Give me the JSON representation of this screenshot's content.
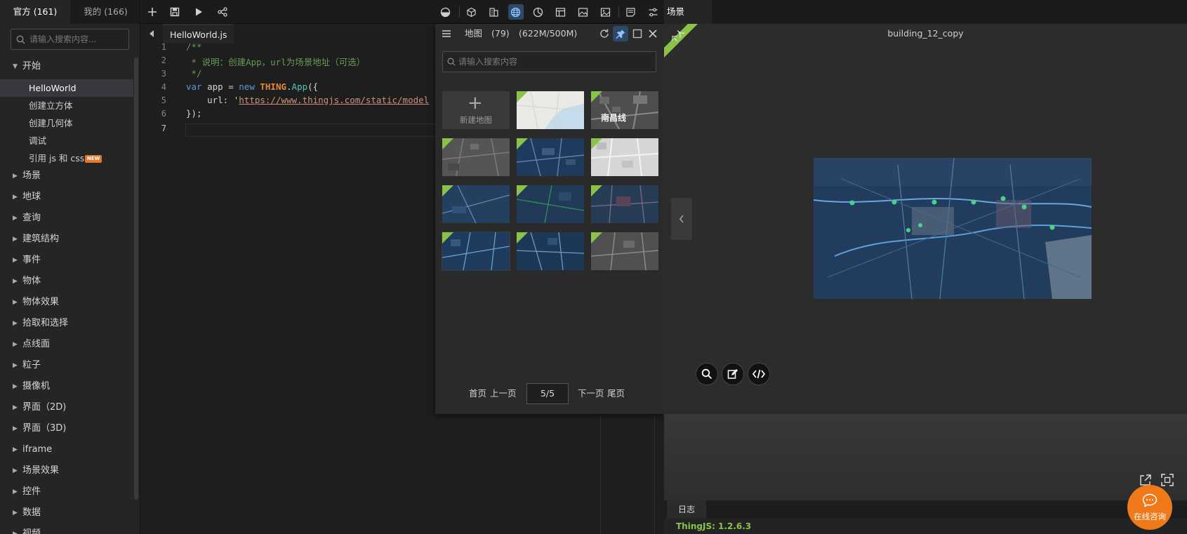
{
  "sidebar": {
    "tabs": [
      {
        "label": "官方",
        "count": "(161)"
      },
      {
        "label": "我的",
        "count": "(166)"
      }
    ],
    "search_placeholder": "请输入搜索内容...",
    "tree": {
      "expanded": {
        "label": "开始",
        "children": [
          {
            "label": "HelloWorld",
            "selected": true
          },
          {
            "label": "创建立方体"
          },
          {
            "label": "创建几何体"
          },
          {
            "label": "调试"
          },
          {
            "label": "引用 js 和 css",
            "badge": "NEW"
          }
        ]
      },
      "collapsed": [
        "场景",
        "地球",
        "查询",
        "建筑结构",
        "事件",
        "物体",
        "物体效果",
        "拾取和选择",
        "点线面",
        "粒子",
        "摄像机",
        "界面（2D)",
        "界面（3D)",
        "iframe",
        "场景效果",
        "控件",
        "数据",
        "视频"
      ]
    }
  },
  "toolbar": {
    "left_icons": [
      "plus-icon",
      "save-icon",
      "run-icon",
      "share-icon"
    ],
    "right_icons": [
      "layers-icon",
      "cube-icon",
      "building-icon",
      "globe-icon",
      "chart-icon",
      "layout-icon",
      "image-icon",
      "gallery-icon",
      "note-icon",
      "settings-icon"
    ],
    "active_icon": "globe-icon"
  },
  "editor": {
    "file_tab": "HelloWorld.js",
    "lines": [
      "1",
      "2",
      "3",
      "4",
      "5",
      "6",
      "7"
    ],
    "code": {
      "l1": "/**",
      "l2": " * 说明：创建App，url为场景地址（可选）",
      "l3": " */",
      "l4_kw": "var",
      "l4_a": " app = ",
      "l4_new": "new",
      "l4_sp": " ",
      "l4_cls": "THING",
      "l4_dot": ".",
      "l4_fn": "App",
      "l4_b": "({",
      "l5_a": "    url: '",
      "l5_str": "https://www.thingjs.com/static/model",
      "l6": "});"
    }
  },
  "map_panel": {
    "title": "地图",
    "count": "(79)",
    "size": "(622M/500M)",
    "search_placeholder": "请输入搜索内容",
    "new_map_label": "新建地图",
    "thumb_road_label": "南昌线",
    "pager": {
      "first": "首页",
      "prev": "上一页",
      "page": "5/5",
      "next": "下一页",
      "last": "尾页"
    }
  },
  "scene": {
    "tab_label": "场景",
    "title": "building_12_copy",
    "ribbon_label": "个人",
    "log_tab": "日志",
    "log_text": "ThingJS: 1.2.6.3",
    "consult_label": "在线咨询"
  },
  "colors": {
    "accent_green": "#8bc34a",
    "accent_orange": "#f07a1a",
    "active_blue": "#2c4a66"
  }
}
